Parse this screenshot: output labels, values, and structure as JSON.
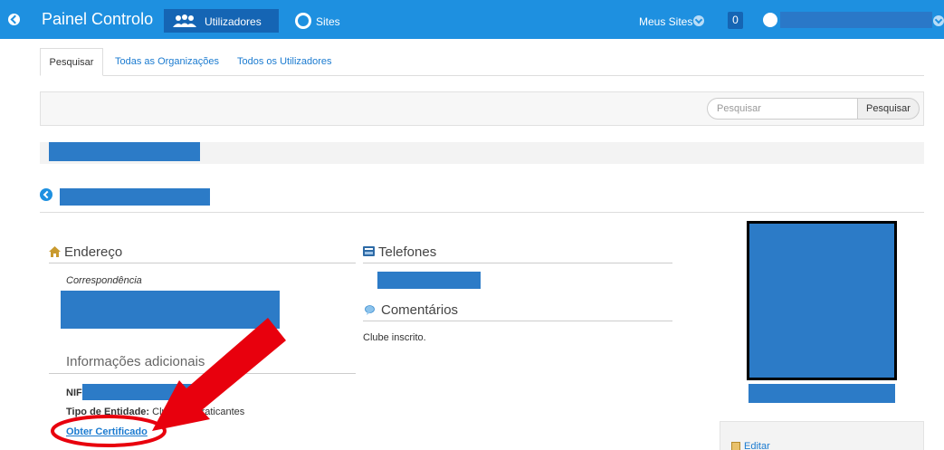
{
  "topbar": {
    "title": "Painel Controlo",
    "tab_users": "Utilizadores",
    "tab_sites": "Sites",
    "meus_sites": "Meus Sites",
    "notification_count": "0"
  },
  "tabs": [
    "Pesquisar",
    "Todas as Organizações",
    "Todos os Utilizadores"
  ],
  "search": {
    "placeholder": "Pesquisar",
    "button": "Pesquisar"
  },
  "address": {
    "heading": "Endereço",
    "type_label": "Correspondência"
  },
  "phones": {
    "heading": "Telefones"
  },
  "comments": {
    "heading": "Comentários",
    "text": "Clube inscrito."
  },
  "additional": {
    "heading": "Informações adicionais",
    "nif_label": "NIF:",
    "entity_type_label": "Tipo de Entidade:",
    "entity_type_value": "Clube de Praticantes",
    "certificate_link": "Obter Certificado"
  },
  "sidebar": {
    "edit_label": "Editar"
  },
  "colors": {
    "topbar": "#1e90e0",
    "link": "#1b7bd0",
    "annotation": "#e8000d"
  }
}
